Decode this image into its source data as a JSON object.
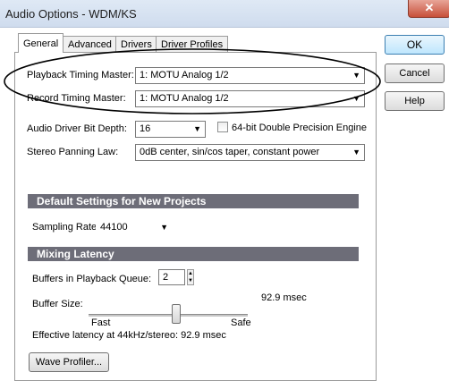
{
  "window": {
    "title": "Audio Options - WDM/KS",
    "close_glyph": "✕"
  },
  "tabs": [
    {
      "label": "General",
      "active": true
    },
    {
      "label": "Advanced",
      "active": false
    },
    {
      "label": "Drivers",
      "active": false
    },
    {
      "label": "Driver Profiles",
      "active": false
    }
  ],
  "buttons": {
    "ok": "OK",
    "cancel": "Cancel",
    "help": "Help",
    "wave_profiler": "Wave Profiler..."
  },
  "general": {
    "playback_label": "Playback Timing Master:",
    "playback_value": "1: MOTU Analog 1/2",
    "record_label": "Record Timing Master:",
    "record_value": "1: MOTU Analog 1/2",
    "bit_depth_label": "Audio Driver Bit Depth:",
    "bit_depth_value": "16",
    "double_precision_label": "64-bit Double Precision Engine",
    "double_precision_checked": false,
    "panning_label": "Stereo Panning Law:",
    "panning_value": "0dB center, sin/cos taper, constant power"
  },
  "defaults_section": {
    "header": "Default Settings for New Projects",
    "sampling_rate_label": "Sampling Rate:",
    "sampling_rate_value": "44100"
  },
  "mixing_section": {
    "header": "Mixing Latency",
    "buffers_label": "Buffers in Playback Queue:",
    "buffers_value": "2",
    "buffer_size_label": "Buffer Size:",
    "buffer_size_readout": "92.9 msec",
    "buffer_size_level": 0.55,
    "fast_label": "Fast",
    "safe_label": "Safe",
    "effective_latency": "Effective latency at 44kHz/stereo: 92.9 msec"
  },
  "icons": {
    "dropdown_arrow": "▼",
    "spin_up": "▲",
    "spin_down": "▼"
  }
}
